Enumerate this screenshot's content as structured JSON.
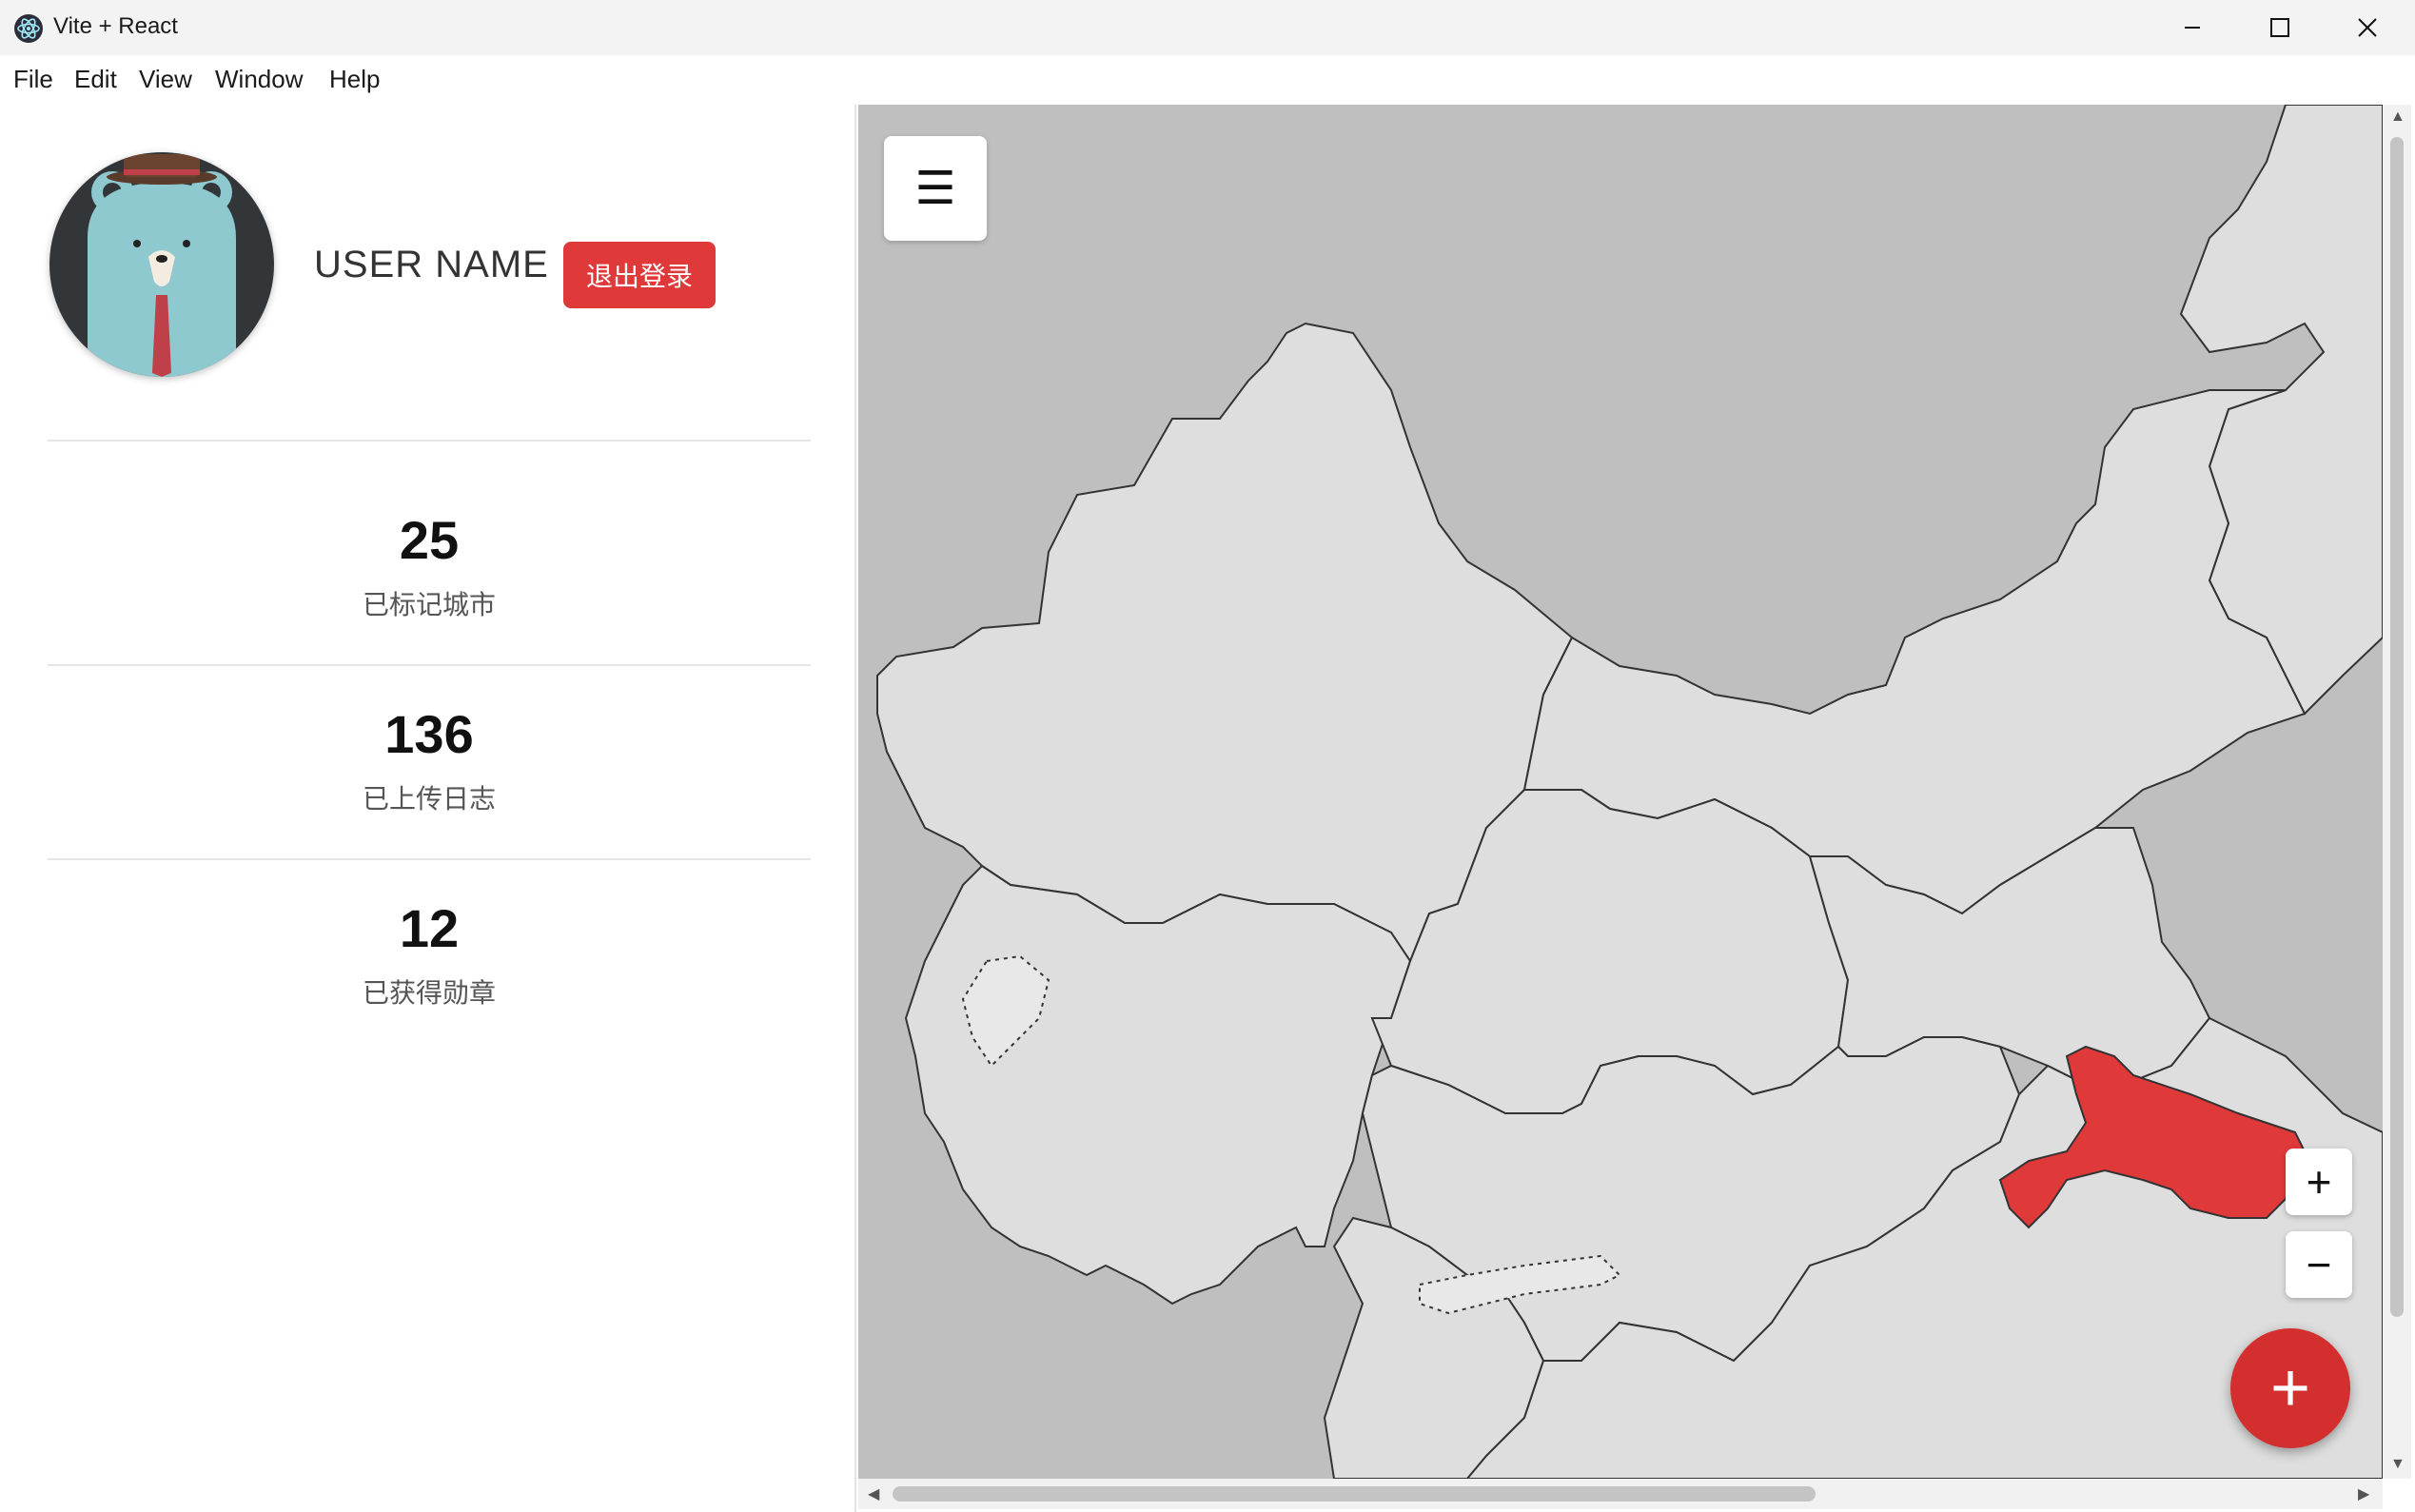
{
  "window": {
    "title": "Vite + React",
    "controls": {
      "minimize": "─",
      "maximize": "☐",
      "close": "✕"
    }
  },
  "menu": [
    "File",
    "Edit",
    "View",
    "Window",
    "Help"
  ],
  "profile": {
    "username": "USER NAME",
    "logout_label": "退出登录",
    "avatar": "bear-avatar"
  },
  "stats": [
    {
      "value": "25",
      "label": "已标记城市"
    },
    {
      "value": "136",
      "label": "已上传日志"
    },
    {
      "value": "12",
      "label": "已获得勋章"
    }
  ],
  "map": {
    "menu_icon": "☰",
    "zoom_in": "+",
    "zoom_out": "−",
    "add_label": "+",
    "highlight_color": "#e0393a",
    "land_color": "#dedede",
    "water_color": "#bfbfbf"
  },
  "colors": {
    "accent": "#e0393a",
    "fab": "#d32f2f"
  }
}
